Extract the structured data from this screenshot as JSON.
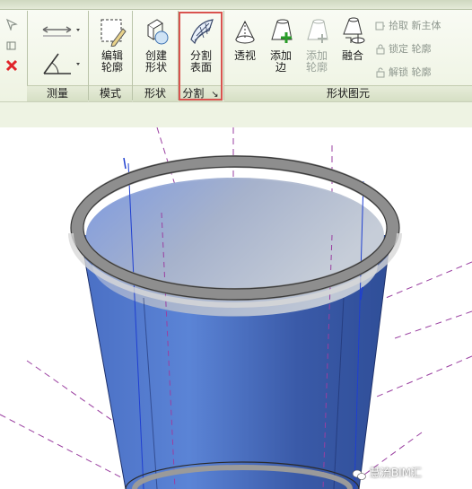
{
  "ribbon": {
    "edit_profile": {
      "label_line1": "编辑",
      "label_line2": "轮廓"
    },
    "create_form": {
      "label_line1": "创建",
      "label_line2": "形状"
    },
    "divide_surface": {
      "label_line1": "分割",
      "label_line2": "表面"
    },
    "perspective": {
      "label": "透视"
    },
    "add_edge": {
      "label_line1": "添加",
      "label_line2": "边"
    },
    "add_profile": {
      "label_line1": "添加",
      "label_line2": "轮廓"
    },
    "dissolve": {
      "label": "融合"
    },
    "pick_new_host": {
      "label": "拾取 新主体"
    },
    "lock_profile": {
      "label": "锁定 轮廓"
    },
    "unlock_profile": {
      "label": "解锁 轮廓"
    },
    "panels": {
      "measure": "测量",
      "mode": "模式",
      "form": "形状",
      "divide": "分割",
      "divide_launcher": "↘",
      "form_element": "形状图元"
    }
  },
  "watermark": {
    "text": "慧流BIM汇"
  },
  "colors": {
    "highlight": "#d9534f",
    "ribbon_bg": "#eef3e2",
    "cylinder_blue": "#3f5fb0",
    "ring_gray": "#a9a9a9"
  }
}
